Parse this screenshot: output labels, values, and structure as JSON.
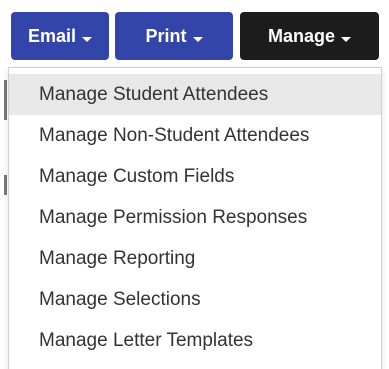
{
  "toolbar": {
    "email_label": "Email",
    "print_label": "Print",
    "manage_label": "Manage"
  },
  "manage_menu": {
    "items": [
      {
        "label": "Manage Student Attendees"
      },
      {
        "label": "Manage Non-Student Attendees"
      },
      {
        "label": "Manage Custom Fields"
      },
      {
        "label": "Manage Permission Responses"
      },
      {
        "label": "Manage Reporting"
      },
      {
        "label": "Manage Selections"
      },
      {
        "label": "Manage Letter Templates"
      }
    ]
  },
  "colors": {
    "primary_button": "#3345a8",
    "active_button": "#1c1c1c",
    "menu_hover": "#e8e8e8",
    "menu_text": "#333333"
  },
  "icons": {
    "dropdown": "caret-down-icon"
  }
}
